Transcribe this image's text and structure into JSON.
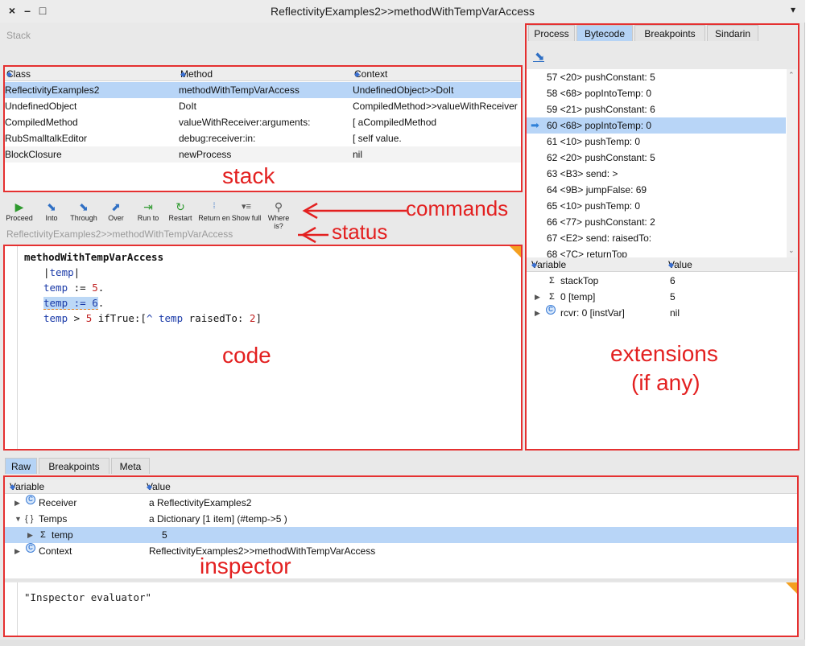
{
  "window": {
    "title": "ReflectivityExamples2>>methodWithTempVarAccess",
    "close_glyph": "×",
    "minimize_glyph": "–",
    "maximize_glyph": "□",
    "menu_glyph": "▾"
  },
  "stack_label": "Stack",
  "stack": {
    "headers": {
      "class": "Class",
      "method": "Method",
      "context": "Context"
    },
    "rows": [
      {
        "class": "ReflectivityExamples2",
        "method": "methodWithTempVarAccess",
        "context": "UndefinedObject>>DoIt"
      },
      {
        "class": "UndefinedObject",
        "method": "DoIt",
        "context": "CompiledMethod>>valueWithReceiver"
      },
      {
        "class": "CompiledMethod",
        "method": "valueWithReceiver:arguments:",
        "context": "[ aCompiledMethod"
      },
      {
        "class": "RubSmalltalkEditor",
        "method": "debug:receiver:in:",
        "context": "[ self value."
      },
      {
        "class": "BlockClosure",
        "method": "newProcess",
        "context": "nil"
      }
    ]
  },
  "toolbar": {
    "proceed": "Proceed",
    "into": "Into",
    "through": "Through",
    "over": "Over",
    "run_to": "Run to",
    "restart": "Restart",
    "return_entered": "Return en",
    "show_full": "Show full",
    "where_is": "Where is?"
  },
  "status_text": "ReflectivityExamples2>>methodWithTempVarAccess",
  "code": {
    "line1": "methodWithTempVarAccess",
    "line2_bar1": "|",
    "line2_temp": "temp",
    "line2_bar2": "|",
    "line3_temp": "temp",
    "line3_assign": " := ",
    "line3_num": "5",
    "line3_dot": ".",
    "line4_highlight": "temp := 6",
    "line4_dot": ".",
    "line5_temp": "temp",
    "line5_a": " > ",
    "line5_num": "5",
    "line5_b": " ifTrue:[",
    "line5_caret": "^",
    "line5_temp2": " temp",
    "line5_c": " raisedTo: ",
    "line5_num2": "2",
    "line5_d": "]"
  },
  "ext_tabs": [
    "Process",
    "Bytecode",
    "Breakpoints",
    "Sindarin"
  ],
  "bytecode": [
    "57 <20> pushConstant: 5",
    "58 <68> popIntoTemp: 0",
    "59 <21> pushConstant: 6",
    "60 <68> popIntoTemp: 0",
    "61 <10> pushTemp: 0",
    "62 <20> pushConstant: 5",
    "63 <B3> send: >",
    "64 <9B> jumpFalse: 69",
    "65 <10> pushTemp: 0",
    "66 <77> pushConstant: 2",
    "67 <E2> send: raisedTo:",
    "68 <7C> returnTop"
  ],
  "ext_vars": {
    "headers": {
      "variable": "Variable",
      "value": "Value"
    },
    "rows": [
      {
        "name": "stackTop",
        "value": "6",
        "icon": "sigma-icon"
      },
      {
        "name": "0 [temp]",
        "value": "5",
        "icon": "sigma-icon"
      },
      {
        "name": "rcvr: 0 [instVar]",
        "value": "nil",
        "icon": "class-icon"
      }
    ]
  },
  "inspector_tabs": [
    "Raw",
    "Breakpoints",
    "Meta"
  ],
  "inspector": {
    "headers": {
      "variable": "Variable",
      "value": "Value"
    },
    "rows": [
      {
        "name": "Receiver",
        "value": "a ReflectivityExamples2"
      },
      {
        "name": "Temps",
        "value": "a Dictionary [1 item] (#temp->5 )"
      },
      {
        "name": "temp",
        "value": "5"
      },
      {
        "name": "Context",
        "value": "ReflectivityExamples2>>methodWithTempVarAccess"
      }
    ],
    "evaluator": "\"Inspector evaluator\""
  },
  "annotations": {
    "stack": "stack",
    "commands": "commands",
    "status": "status",
    "code": "code",
    "extensions_1": "extensions",
    "extensions_2": "(if any)",
    "inspector": "inspector"
  },
  "colors": {
    "annotation": "#e53030",
    "selection": "#b8d5f7",
    "active_tab": "#b5d3f5"
  }
}
